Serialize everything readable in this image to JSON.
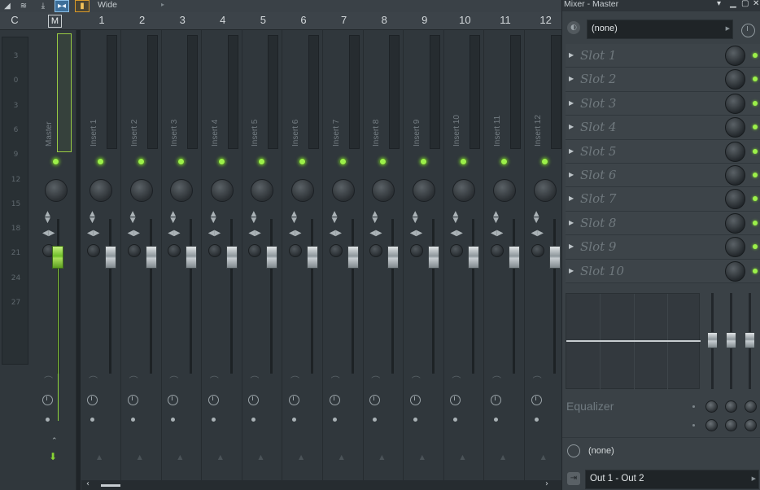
{
  "toolbar": {
    "preset": "Wide",
    "icons": [
      "menu-arrow-icon",
      "layers-icon",
      "pin-icon",
      "split-view-icon",
      "folder-icon"
    ]
  },
  "header": {
    "current_label": "C",
    "master_label": "M",
    "inserts": [
      "1",
      "2",
      "3",
      "4",
      "5",
      "6",
      "7",
      "8",
      "9",
      "10",
      "11",
      "12"
    ]
  },
  "scale": [
    "3",
    "0",
    "3",
    "6",
    "9",
    "12",
    "15",
    "18",
    "21",
    "24",
    "27"
  ],
  "strips": {
    "master": "Master",
    "inserts": [
      "Insert 1",
      "Insert 2",
      "Insert 3",
      "Insert 4",
      "Insert 5",
      "Insert 6",
      "Insert 7",
      "Insert 8",
      "Insert 9",
      "Insert 10",
      "Insert 11",
      "Insert 12"
    ]
  },
  "panel": {
    "title": "Mixer - Master",
    "preset": "(none)",
    "slots": [
      "Slot 1",
      "Slot 2",
      "Slot 3",
      "Slot 4",
      "Slot 5",
      "Slot 6",
      "Slot 7",
      "Slot 8",
      "Slot 9",
      "Slot 10"
    ],
    "eq_label": "Equalizer",
    "send": "(none)",
    "output": "Out 1 - Out 2"
  },
  "colors": {
    "led_green": "#9cf04a",
    "master_highlight": "#9acc43",
    "toolbar_blue": "#3c6f9a",
    "toolbar_orange": "#d99a2a"
  }
}
